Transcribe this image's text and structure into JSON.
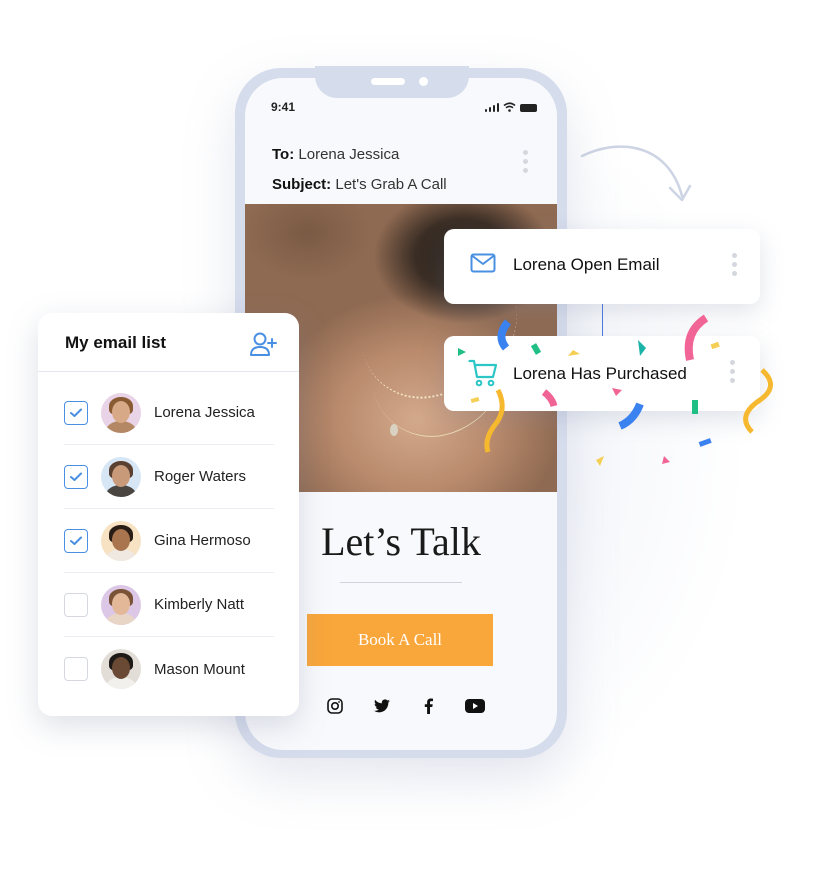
{
  "phone": {
    "status_time": "9:41",
    "email": {
      "to_label": "To:",
      "to_value": "Lorena Jessica",
      "subject_label": "Subject:",
      "subject_value": "Let's Grab A Call"
    },
    "headline": "Let’s Talk",
    "cta_label": "Book A Call",
    "socials": [
      "instagram-icon",
      "twitter-icon",
      "facebook-icon",
      "youtube-icon"
    ]
  },
  "email_list": {
    "title": "My email list",
    "add_icon": "add-user-icon",
    "contacts": [
      {
        "name": "Lorena Jessica",
        "checked": true
      },
      {
        "name": "Roger Waters",
        "checked": true
      },
      {
        "name": "Gina Hermoso",
        "checked": true
      },
      {
        "name": "Kimberly Natt",
        "checked": false
      },
      {
        "name": "Mason Mount",
        "checked": false
      }
    ]
  },
  "notifications": [
    {
      "label": "Lorena Open Email",
      "icon": "mail-icon"
    },
    {
      "label": "Lorena Has Purchased",
      "icon": "cart-icon"
    }
  ],
  "colors": {
    "accent_blue": "#4a90e2",
    "cta_orange": "#f9a63a",
    "phone_frame": "#d5dcec",
    "cart_teal": "#2cc6c6"
  }
}
